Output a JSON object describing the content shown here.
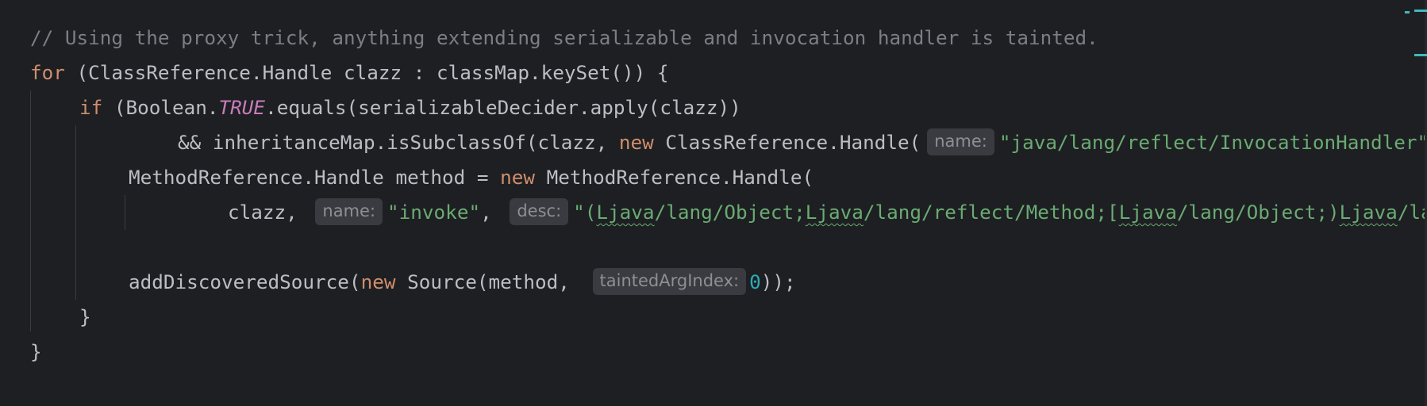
{
  "editor": {
    "line1": {
      "comment": "// Using the proxy trick, anything extending serializable and invocation handler is tainted."
    },
    "line2": {
      "kw_for": "for",
      "rest": " (ClassReference.Handle clazz : classMap.keySet()) {"
    },
    "line3": {
      "kw_if": "if",
      "pre": " (Boolean.",
      "const": "TRUE",
      "post": ".equals(serializableDecider.apply(clazz))"
    },
    "line4": {
      "pre": "&& inheritanceMap.isSubclassOf(clazz, ",
      "kw_new": "new",
      "mid": " ClassReference.Handle(",
      "hint_name": "name:",
      "str": "\"java/lang/reflect/InvocationHandler\""
    },
    "line5": {
      "pre": "MethodReference.Handle method = ",
      "kw_new": "new",
      "post": " MethodReference.Handle("
    },
    "line6": {
      "pre": "clazz, ",
      "hint_name": "name:",
      "str_invoke": "\"invoke\"",
      "comma": ", ",
      "hint_desc": "desc:",
      "desc_s1": "\"(",
      "desc_w1": "Ljava",
      "desc_s2": "/lang/Object;",
      "desc_w2": "Ljava",
      "desc_s3": "/lang/reflect/Method;[",
      "desc_w3": "Ljava",
      "desc_s4": "/lang/Object;)",
      "desc_w4": "Ljava",
      "desc_s5": "/lang/Object;\""
    },
    "line8": {
      "pre": "addDiscoveredSource(",
      "kw_new": "new",
      "mid": " Source(method, ",
      "hint_index": "taintedArgIndex:",
      "num": "0",
      "post": "));"
    },
    "line9": {
      "brace": "}"
    },
    "line10": {
      "brace": "}"
    }
  },
  "colors": {
    "background": "#1e1f22",
    "text": "#bcbec4",
    "comment": "#7a7e85",
    "keyword": "#cf8e6d",
    "string": "#6aab73",
    "number": "#2aacb8",
    "constant": "#c77dbb",
    "hint_bg": "#393b40",
    "hint_text": "#8c8f96",
    "scroll_marker": "#3fb9bf"
  }
}
